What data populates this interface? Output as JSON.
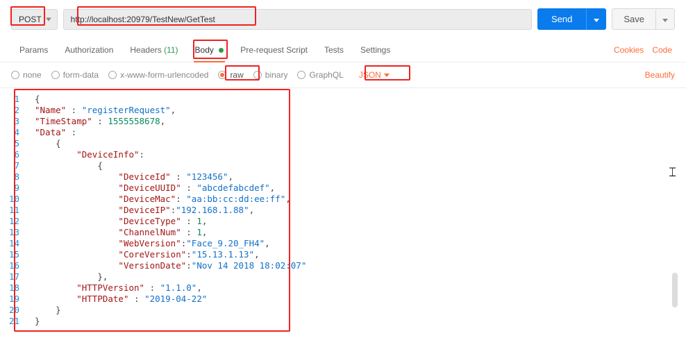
{
  "request": {
    "method": "POST",
    "url": "http://localhost:20979/TestNew/GetTest",
    "send_label": "Send",
    "save_label": "Save"
  },
  "tabs": {
    "params": "Params",
    "authorization": "Authorization",
    "headers": "Headers",
    "headers_count": "(11)",
    "body": "Body",
    "prerequest": "Pre-request Script",
    "tests": "Tests",
    "settings": "Settings",
    "cookies": "Cookies",
    "code": "Code"
  },
  "body_types": {
    "none": "none",
    "formdata": "form-data",
    "urlencoded": "x-www-form-urlencoded",
    "raw": "raw",
    "binary": "binary",
    "graphql": "GraphQL",
    "lang": "JSON",
    "beautify": "Beautify"
  },
  "payload": {
    "Name": "registerRequest",
    "TimeStamp": 1555558678,
    "Data": {
      "DeviceInfo": {
        "DeviceId": "123456",
        "DeviceUUID": "abcdefabcdef",
        "DeviceMac": "aa:bb:cc:dd:ee:ff",
        "DeviceIP": "192.168.1.88",
        "DeviceType": 1,
        "ChannelNum": 1,
        "WebVersion": "Face_9.20_FH4",
        "CoreVersion": "15.13.1.13",
        "VersionDate": "Nov 14 2018 18:02:07"
      },
      "HTTPVersion": "1.1.0",
      "HTTPDate": "2019-04-22"
    }
  },
  "editor_tokens": [
    [
      [
        "brace",
        "{"
      ]
    ],
    [
      [
        "key",
        "\"Name\""
      ],
      [
        "punc",
        " : "
      ],
      [
        "str",
        "\"registerRequest\""
      ],
      [
        "punc",
        ","
      ]
    ],
    [
      [
        "key",
        "\"TimeStamp\""
      ],
      [
        "punc",
        " : "
      ],
      [
        "num",
        "1555558678"
      ],
      [
        "punc",
        ","
      ]
    ],
    [
      [
        "key",
        "\"Data\""
      ],
      [
        "punc",
        " :"
      ]
    ],
    [
      [
        "punc",
        "    "
      ],
      [
        "brace",
        "{"
      ]
    ],
    [
      [
        "punc",
        "        "
      ],
      [
        "key",
        "\"DeviceInfo\""
      ],
      [
        "punc",
        ":"
      ]
    ],
    [
      [
        "punc",
        "            "
      ],
      [
        "brace",
        "{"
      ]
    ],
    [
      [
        "punc",
        "                "
      ],
      [
        "key",
        "\"DeviceId\""
      ],
      [
        "punc",
        " : "
      ],
      [
        "str",
        "\"123456\""
      ],
      [
        "punc",
        ","
      ]
    ],
    [
      [
        "punc",
        "                "
      ],
      [
        "key",
        "\"DeviceUUID\""
      ],
      [
        "punc",
        " : "
      ],
      [
        "str",
        "\"abcdefabcdef\""
      ],
      [
        "punc",
        ","
      ]
    ],
    [
      [
        "punc",
        "                "
      ],
      [
        "key",
        "\"DeviceMac\""
      ],
      [
        "punc",
        ": "
      ],
      [
        "str",
        "\"aa:bb:cc:dd:ee:ff\""
      ],
      [
        "punc",
        ","
      ]
    ],
    [
      [
        "punc",
        "                "
      ],
      [
        "key",
        "\"DeviceIP\""
      ],
      [
        "punc",
        ":"
      ],
      [
        "str",
        "\"192.168.1.88\""
      ],
      [
        "punc",
        ","
      ]
    ],
    [
      [
        "punc",
        "                "
      ],
      [
        "key",
        "\"DeviceType\""
      ],
      [
        "punc",
        " : "
      ],
      [
        "num",
        "1"
      ],
      [
        "punc",
        ","
      ]
    ],
    [
      [
        "punc",
        "                "
      ],
      [
        "key",
        "\"ChannelNum\""
      ],
      [
        "punc",
        " : "
      ],
      [
        "num",
        "1"
      ],
      [
        "punc",
        ","
      ]
    ],
    [
      [
        "punc",
        "                "
      ],
      [
        "key",
        "\"WebVersion\""
      ],
      [
        "punc",
        ":"
      ],
      [
        "str",
        "\"Face_9.20_FH4\""
      ],
      [
        "punc",
        ","
      ]
    ],
    [
      [
        "punc",
        "                "
      ],
      [
        "key",
        "\"CoreVersion\""
      ],
      [
        "punc",
        ":"
      ],
      [
        "str",
        "\"15.13.1.13\""
      ],
      [
        "punc",
        ","
      ]
    ],
    [
      [
        "punc",
        "                "
      ],
      [
        "key",
        "\"VersionDate\""
      ],
      [
        "punc",
        ":"
      ],
      [
        "str",
        "\"Nov 14 2018 18:02:07\""
      ]
    ],
    [
      [
        "punc",
        "            "
      ],
      [
        "brace",
        "}"
      ],
      [
        "punc",
        ","
      ]
    ],
    [
      [
        "punc",
        "        "
      ],
      [
        "key",
        "\"HTTPVersion\""
      ],
      [
        "punc",
        " : "
      ],
      [
        "str",
        "\"1.1.0\""
      ],
      [
        "punc",
        ","
      ]
    ],
    [
      [
        "punc",
        "        "
      ],
      [
        "key",
        "\"HTTPDate\""
      ],
      [
        "punc",
        " : "
      ],
      [
        "str",
        "\"2019-04-22\""
      ]
    ],
    [
      [
        "punc",
        "    "
      ],
      [
        "brace",
        "}"
      ]
    ],
    [
      [
        "brace",
        "}"
      ]
    ]
  ]
}
